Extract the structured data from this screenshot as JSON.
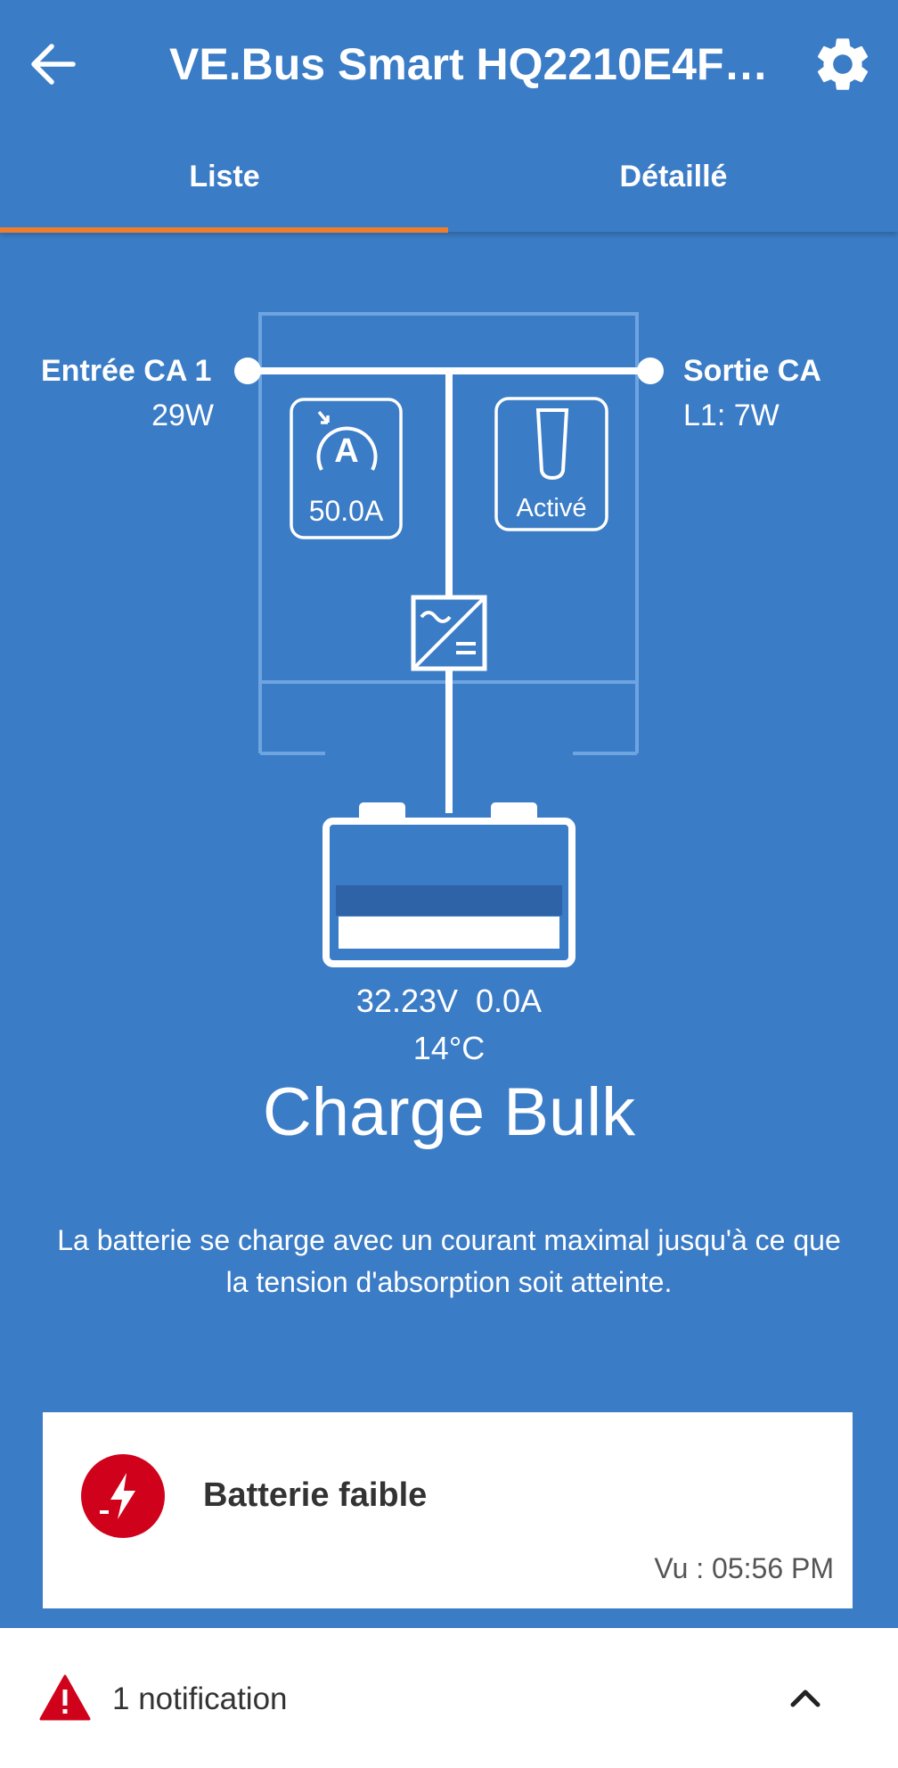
{
  "header": {
    "title": "VE.Bus Smart HQ2210E4FM...",
    "back_icon": "arrow-left-icon",
    "settings_icon": "gear-icon"
  },
  "tabs": [
    {
      "label": "Liste",
      "active": true
    },
    {
      "label": "Détaillé",
      "active": false
    }
  ],
  "ac_input": {
    "title": "Entrée CA 1",
    "value": "29W"
  },
  "ac_output": {
    "title": "Sortie CA",
    "value": "L1: 7W"
  },
  "current_limit": {
    "value": "50.0A",
    "icon": "amp-gauge-icon"
  },
  "mode_switch": {
    "label": "Activé",
    "icon": "switch-icon"
  },
  "battery": {
    "voltage_current": "32.23V  0.0A",
    "temperature": "14°C"
  },
  "charge_state": {
    "title": "Charge Bulk",
    "step_active": 1,
    "step_count": 3,
    "description": "La batterie se charge avec un courant maximal jusqu'à ce que la tension d'absorption soit atteinte."
  },
  "alert": {
    "title": "Batterie faible",
    "seen": "Vu : 05:56 PM",
    "icon": "low-battery-alert-icon"
  },
  "bottom_bar": {
    "text": "1 notification",
    "icon": "warning-triangle-icon",
    "chevron": "chevron-up-icon"
  },
  "colors": {
    "primary": "#3b7cc6",
    "accent": "#ef7d2e",
    "alert_red": "#d0021b",
    "white": "#ffffff"
  }
}
